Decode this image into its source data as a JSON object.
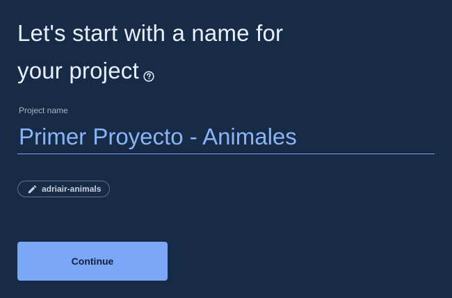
{
  "heading": {
    "line1": "Let's start with a name for",
    "line2": "your project",
    "help_icon": "help-circle-icon"
  },
  "project_name_field": {
    "label": "Project name",
    "value": "Primer Proyecto - Animales"
  },
  "project_id_chip": {
    "icon": "pencil-icon",
    "label": "adriair-animals"
  },
  "continue_button": {
    "label": "Continue"
  },
  "colors": {
    "background": "#182b46",
    "accent": "#8ab4f8",
    "button": "#7ba7f7"
  }
}
